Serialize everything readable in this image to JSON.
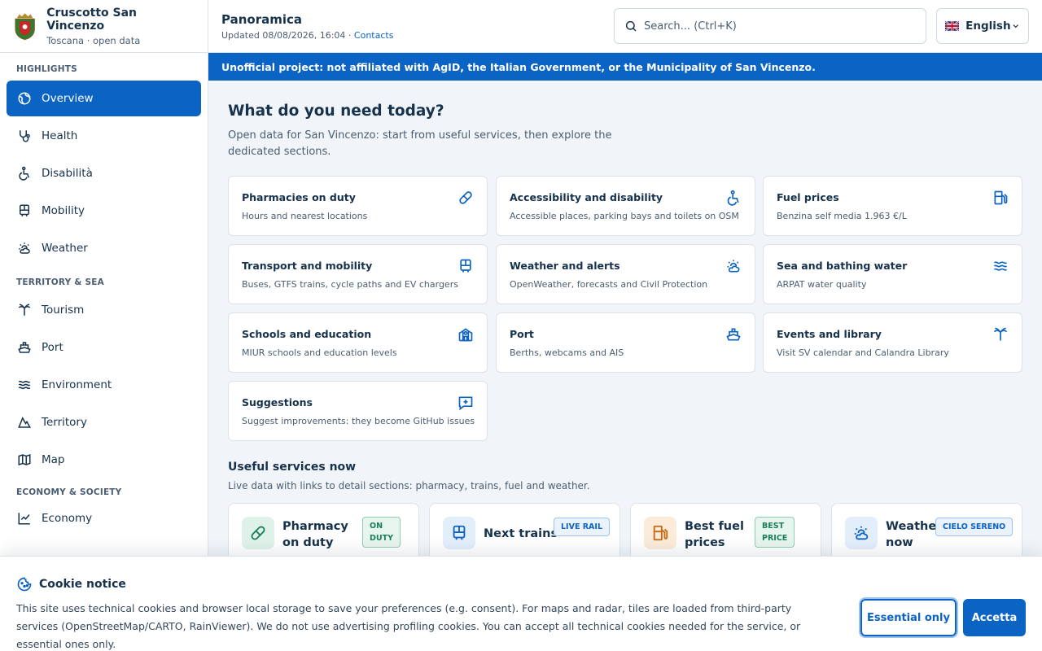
{
  "brand": {
    "title": "Cruscotto San Vincenzo",
    "subtitle": "Toscana · open data"
  },
  "sidebar": {
    "groups": [
      {
        "title": "HIGHLIGHTS",
        "items": [
          {
            "label": "Overview",
            "icon": "globe-icon",
            "active": true
          },
          {
            "label": "Health",
            "icon": "stethoscope-icon"
          },
          {
            "label": "Disabilità",
            "icon": "accessibility-icon"
          },
          {
            "label": "Mobility",
            "icon": "bus-icon"
          },
          {
            "label": "Weather",
            "icon": "sun-cloud-icon"
          }
        ]
      },
      {
        "title": "TERRITORY & SEA",
        "items": [
          {
            "label": "Tourism",
            "icon": "palm-tree-icon"
          },
          {
            "label": "Port",
            "icon": "ship-icon"
          },
          {
            "label": "Environment",
            "icon": "waves-icon"
          },
          {
            "label": "Territory",
            "icon": "mountain-icon"
          },
          {
            "label": "Map",
            "icon": "map-icon"
          }
        ]
      },
      {
        "title": "ECONOMY & SOCIETY",
        "items": [
          {
            "label": "Economy",
            "icon": "chart-icon"
          }
        ]
      }
    ]
  },
  "header": {
    "title": "Panoramica",
    "updated": "Updated 08/08/2026, 16:04 ·",
    "contacts_link": "Contacts",
    "search_placeholder": "Search... (Ctrl+K)",
    "language": "English"
  },
  "banner": "Unofficial project: not affiliated with AgID, the Italian Government, or the Municipality of San Vincenzo.",
  "main": {
    "heading": "What do you need today?",
    "intro": "Open data for San Vincenzo: start from useful services, then explore the dedicated sections.",
    "cards": [
      {
        "title": "Pharmacies on duty",
        "desc": "Hours and nearest locations",
        "icon": "pill-icon"
      },
      {
        "title": "Accessibility and disability",
        "desc": "Accessible places, parking bays and toilets on OSM",
        "icon": "accessibility-icon"
      },
      {
        "title": "Fuel prices",
        "desc": "Benzina self media 1.963 €/L",
        "icon": "fuel-icon"
      },
      {
        "title": "Transport and mobility",
        "desc": "Buses, GTFS trains, cycle paths and EV chargers",
        "icon": "bus-icon"
      },
      {
        "title": "Weather and alerts",
        "desc": "OpenWeather, forecasts and Civil Protection",
        "icon": "sun-cloud-icon"
      },
      {
        "title": "Sea and bathing water",
        "desc": "ARPAT water quality",
        "icon": "waves-icon"
      },
      {
        "title": "Schools and education",
        "desc": "MIUR schools and education levels",
        "icon": "school-icon"
      },
      {
        "title": "Port",
        "desc": "Berths, webcams and AIS",
        "icon": "ship-icon"
      },
      {
        "title": "Events and library",
        "desc": "Visit SV calendar and Calandra Library",
        "icon": "palm-tree-icon"
      },
      {
        "title": "Suggestions",
        "desc": "Suggest improvements: they become GitHub issues",
        "icon": "message-plus-icon"
      }
    ],
    "services_heading": "Useful services now",
    "services_sub": "Live data with links to detail sections: pharmacy, trains, fuel and weather.",
    "services": [
      {
        "title_l1": "Pharmacy",
        "title_l2": "on duty",
        "badge_l1": "ON",
        "badge_l2": "DUTY",
        "icon": "pill-icon",
        "color": "#1a7f5a"
      },
      {
        "title_l1": "Next trains",
        "title_l2": "",
        "badge_l1": "LIVE RAIL",
        "badge_l2": "",
        "icon": "bus-icon",
        "color": "#0b63c4"
      },
      {
        "title_l1": "Best fuel",
        "title_l2": "prices",
        "badge_l1": "BEST",
        "badge_l2": "PRICE",
        "icon": "fuel-icon",
        "color": "#c26a12"
      },
      {
        "title_l1": "Weather",
        "title_l2": "now",
        "badge_l1": "CIELO SERENO",
        "badge_l2": "",
        "icon": "sun-cloud-icon",
        "color": "#0b63c4"
      }
    ]
  },
  "cookie": {
    "title": "Cookie notice",
    "text": "This site uses technical cookies and browser local storage to save your preferences (e.g. consent). For maps and radar, tiles are loaded from third-party services (OpenStreetMap/CARTO, RainViewer). We do not use advertising profiling cookies. You can accept all technical cookies needed for the service, or essential ones only.",
    "essential_label": "Essential only",
    "accept_label": "Accetta"
  },
  "colors": {
    "accent": "#0b63c4",
    "text": "#17324d",
    "muted": "#4a5d72",
    "background": "#f1f5f9"
  }
}
